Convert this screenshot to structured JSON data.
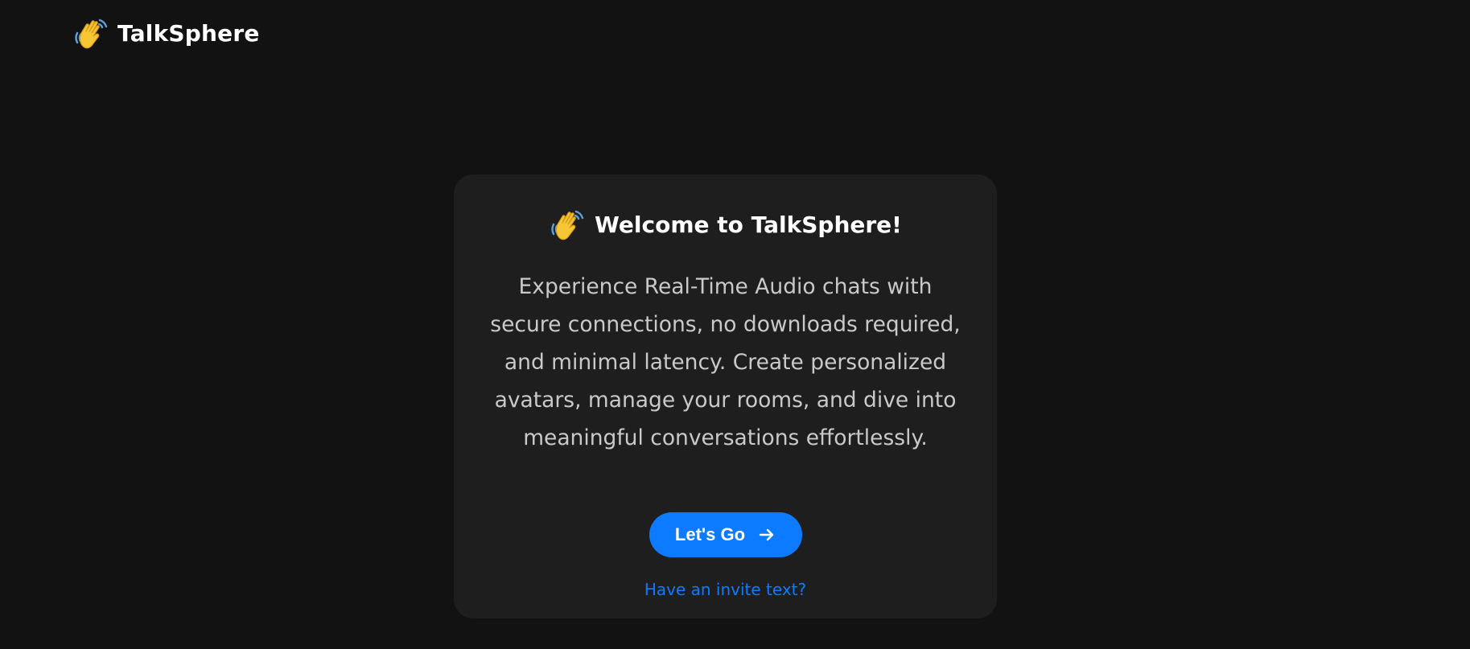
{
  "header": {
    "brand_name": "TalkSphere",
    "brand_icon": "waving-hand-icon"
  },
  "card": {
    "title": "Welcome to TalkSphere!",
    "title_icon": "waving-hand-icon",
    "description": "Experience Real-Time Audio chats with secure connections, no downloads required, and minimal latency. Create personalized avatars, manage your rooms, and dive into meaningful conversations effortlessly.",
    "primary_button_label": "Let's Go",
    "primary_button_icon": "arrow-right-icon",
    "invite_link_label": "Have an invite text?"
  },
  "colors": {
    "background": "#121212",
    "card_background": "#1e1e1e",
    "accent": "#0d7bff",
    "text_primary": "#ffffff",
    "text_secondary": "#c9c9c9"
  }
}
